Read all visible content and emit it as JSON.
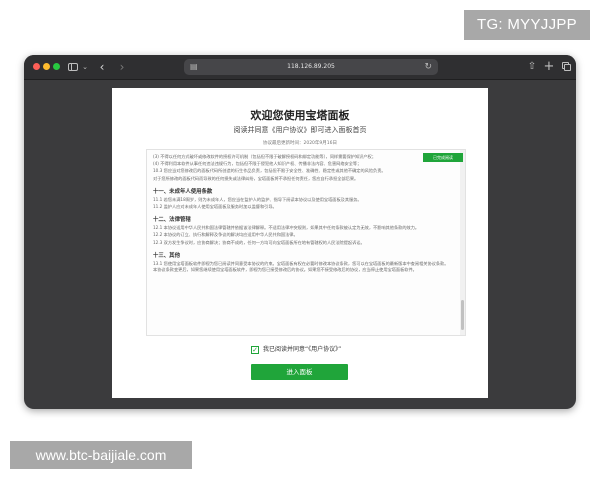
{
  "watermarks": {
    "top": "TG: MYYJJPP",
    "bottom": "www.btc-baijiale.com"
  },
  "browser": {
    "url": "118.126.89.205",
    "icons": [
      "sidebar-icon",
      "chevron-down-icon",
      "back-icon",
      "forward-icon",
      "page-icon",
      "reload-icon",
      "share-icon",
      "plus-icon",
      "tabs-icon"
    ]
  },
  "page": {
    "title": "欢迎您使用宝塔面板",
    "subtitle": "阅读并同意《用户协议》即可进入面板首页",
    "updated": "协议最后更新时间：2020年9月16日",
    "read_badge": "已完成阅读",
    "agreement": {
      "sections": [
        {
          "heading": "",
          "paragraphs": [
            "(3) 不得以任何方式破坏或修改软件的授权许可机制（包括但不限于破解授权码和绑定功能等），同样需要保护知识产权；",
            "(4) 不得利用本软件从事任何违法违规行为，包括但不限于侵犯他人知识产权、传播非法内容、危害网络安全等；",
            "10.3 您应当对您修改后的面板代码所创造的衍生作品负责，包括但不限于安全性、准确性、稳定性或其他不确定的风险负责。",
            "对于您所修改的面板代码而导致的任何损失或法律纠纷，宝塔面板将不承担任何责任，您应自行承担全部后果。"
          ]
        },
        {
          "heading": "十一、未成年人使用条款",
          "paragraphs": [
            "11.1 若您未满18周岁，则为未成年人，您应当在监护人的监护、指导下阅读本协议以及使用宝塔面板及其服务。",
            "11.2 监护人应对未成年人使用宝塔面板及服务时加以监督和引导。"
          ]
        },
        {
          "heading": "十二、法律管辖",
          "paragraphs": [
            "12.1 本协议适用中华人民共和国法律管辖并依据该法律解释。不适用法律冲突规则，如果其中任何条款被认定为无效，不影响其他条款的效力。",
            "12.2 本协议的订立、执行和解释及争议的解决均应适用中华人民共和国法律。",
            "12.3 双方发生争议时，应协商解决；协商不成的，任何一方均可向宝塔面板所在地有管辖权的人民法院提起诉讼。"
          ]
        },
        {
          "heading": "十三、其他",
          "paragraphs": [
            "13.1 您使用宝塔面板软件即视为您已阅读并同意受本协议的约束。宝塔面板有权在必要时修改本协议条款，您可以在宝塔面板的最新版本中查阅相关协议条款。本协议条款变更后，如果您继续使用宝塔面板软件，即视为您已接受修改后的协议。如果您不接受修改后的协议，应当停止使用宝塔面板软件。"
          ]
        }
      ]
    },
    "agree_label": "我已阅读并同意“《用户协议》”",
    "enter_button": "进入面板"
  },
  "colors": {
    "accent": "#20a53a",
    "window_bg": "#3b3b3d",
    "toolbar_bg": "#2f2f31"
  }
}
